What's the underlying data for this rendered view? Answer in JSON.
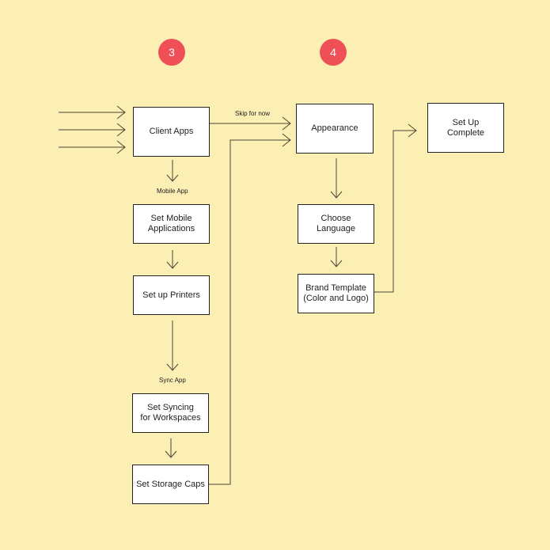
{
  "steps": [
    {
      "number": "3",
      "color": "#ef4f57"
    },
    {
      "number": "4",
      "color": "#ef4f57"
    }
  ],
  "nodes": {
    "client_apps": "Client Apps",
    "set_mobile_applications": "Set Mobile\nApplications",
    "set_up_printers": "Set up Printers",
    "set_syncing": "Set Syncing\nfor Workspaces",
    "set_storage_caps": "Set Storage Caps",
    "appearance": "Appearance",
    "choose_language": "Choose\nLanguage",
    "brand_template": "Brand Template\n(Color and Logo)",
    "set_up_complete": "Set Up\nComplete"
  },
  "edge_labels": {
    "skip_for_now": "Skip for now",
    "mobile_app": "Mobile App",
    "sync_app": "Sync App"
  },
  "colors": {
    "background": "#fcefb4",
    "line": "#4a4637"
  }
}
